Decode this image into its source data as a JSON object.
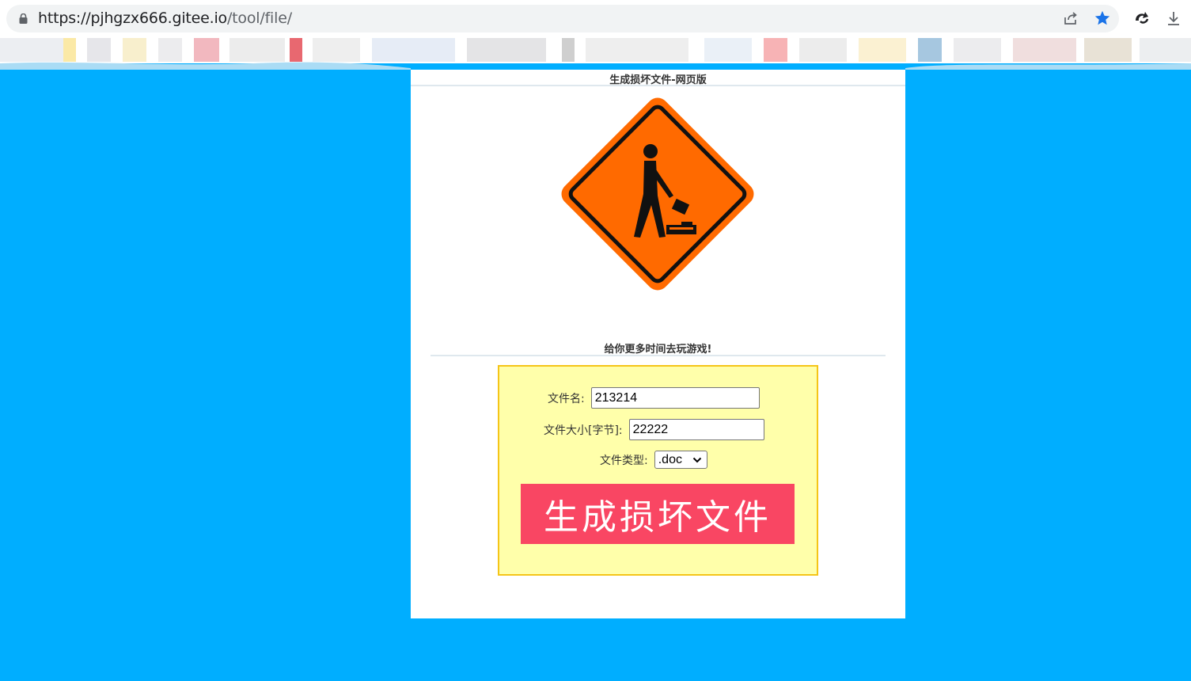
{
  "browser": {
    "url_host": "https://pjhgzx666.gitee.io",
    "url_path": "/tool/file/"
  },
  "page": {
    "title": "生成损坏文件-网页版",
    "slogan": "给你更多时间去玩游戏!",
    "sign_icon": "construction-worker-sign"
  },
  "form": {
    "filename_label": "文件名:",
    "filename_value": "213214",
    "filesize_label": "文件大小[字节]:",
    "filesize_value": "22222",
    "filetype_label": "文件类型:",
    "filetype_selected": ".doc",
    "generate_label": "生成损坏文件"
  },
  "colors": {
    "page_bg": "#00aeff",
    "sign_orange": "#ff6a00",
    "form_bg": "#ffffaa",
    "form_border": "#f5c518",
    "button_bg": "#f94663",
    "star_blue": "#1a73e8"
  }
}
